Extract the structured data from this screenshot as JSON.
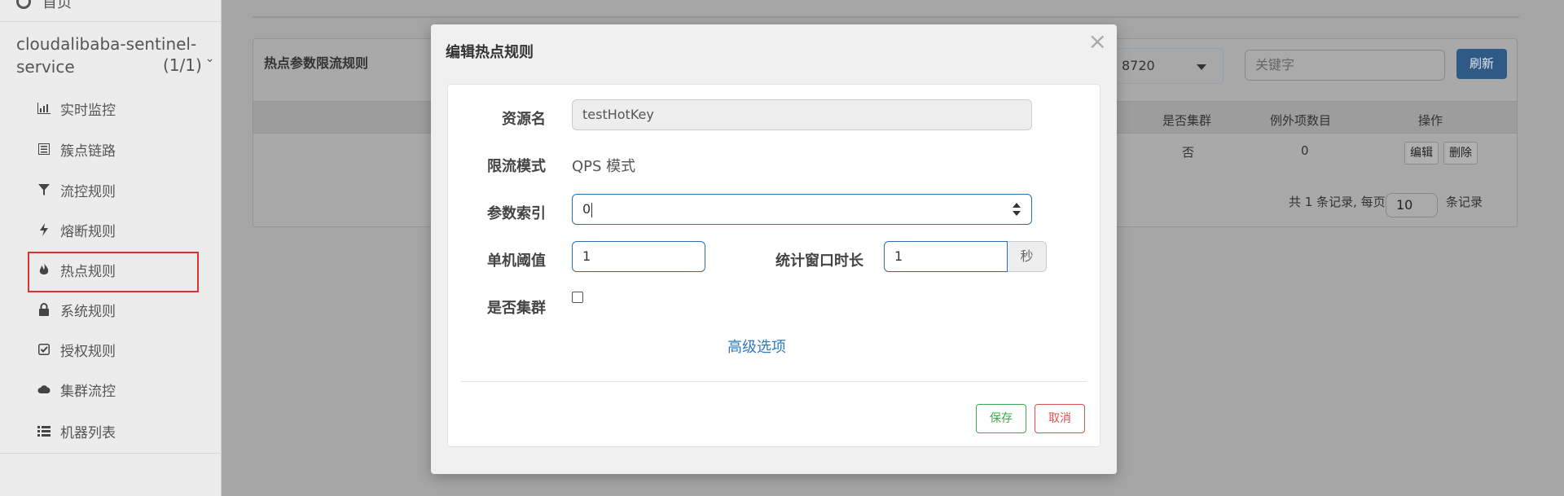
{
  "sidebar": {
    "home_label": "首页",
    "app_name": "cloudalibaba-sentinel-service",
    "app_count": "(1/1)",
    "items": [
      {
        "label": "实时监控",
        "icon": "bar-chart-icon"
      },
      {
        "label": "簇点链路",
        "icon": "list-icon"
      },
      {
        "label": "流控规则",
        "icon": "filter-icon"
      },
      {
        "label": "熔断规则",
        "icon": "flash-icon"
      },
      {
        "label": "热点规则",
        "icon": "fire-icon"
      },
      {
        "label": "系统规则",
        "icon": "lock-icon"
      },
      {
        "label": "授权规则",
        "icon": "check-icon"
      },
      {
        "label": "集群流控",
        "icon": "cloud-icon"
      },
      {
        "label": "机器列表",
        "icon": "list-bullet-icon"
      }
    ]
  },
  "main": {
    "panel_title": "热点参数限流规则",
    "machine_value": "8720",
    "search_placeholder": "关键字",
    "refresh_label": "刷新",
    "columns": {
      "cluster": "是否集群",
      "exceptions": "例外项数目",
      "ops": "操作"
    },
    "row": {
      "cluster": "否",
      "exceptions": "0",
      "edit": "编辑",
      "delete": "删除"
    },
    "pager": {
      "prefix": "共 1 条记录, 每页",
      "page_size": "10",
      "suffix": "条记录"
    }
  },
  "modal": {
    "title": "编辑热点规则",
    "close": "×",
    "resource_label": "资源名",
    "resource_value": "testHotKey",
    "mode_label": "限流模式",
    "mode_value": "QPS 模式",
    "param_index_label": "参数索引",
    "param_index_value": "0",
    "threshold_label": "单机阈值",
    "threshold_value": "1",
    "window_label": "统计窗口时长",
    "window_value": "1",
    "window_unit": "秒",
    "cluster_label": "是否集群",
    "advanced_label": "高级选项",
    "save_label": "保存",
    "cancel_label": "取消"
  },
  "colors": {
    "primary": "#2f7bbf",
    "save": "#3fa84d",
    "cancel": "#d9534f",
    "highlight": "#e03030"
  }
}
